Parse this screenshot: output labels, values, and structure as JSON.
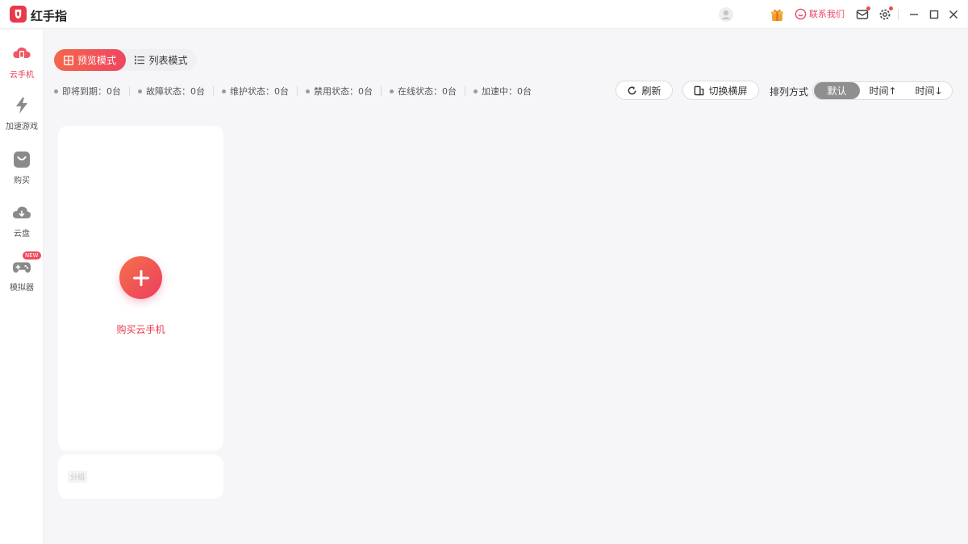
{
  "titlebar": {
    "logo_text": "红手指",
    "app_title": "红手指",
    "contact_label": "联系我们"
  },
  "sidebar": {
    "items": [
      {
        "label": "云手机",
        "icon": "cloud-phone-icon",
        "active": true
      },
      {
        "label": "加速游戏",
        "icon": "lightning-icon"
      },
      {
        "label": "购买",
        "icon": "shopping-bag-icon"
      },
      {
        "label": "云盘",
        "icon": "cloud-icon"
      },
      {
        "label": "模拟器",
        "icon": "gamepad-icon",
        "badge": "NEW"
      }
    ]
  },
  "view_modes": {
    "preview": "预览模式",
    "list": "列表模式"
  },
  "stats": [
    "即将到期：0台",
    "故障状态：0台",
    "维护状态：0台",
    "禁用状态：0台",
    "在线状态：0台",
    "加速中：0台"
  ],
  "toolbar": {
    "refresh": "刷新",
    "switch_screen": "切换横屏",
    "sort_label": "排列方式",
    "sort_options": [
      "默认",
      "时间↑",
      "时间↓"
    ],
    "sort_selected": "默认"
  },
  "cards": {
    "add_label": "购买云手机",
    "small_label": "分组"
  },
  "colors": {
    "accent": "#e8394a",
    "gradient_start": "#f4674a",
    "gradient_end": "#ee4660"
  }
}
